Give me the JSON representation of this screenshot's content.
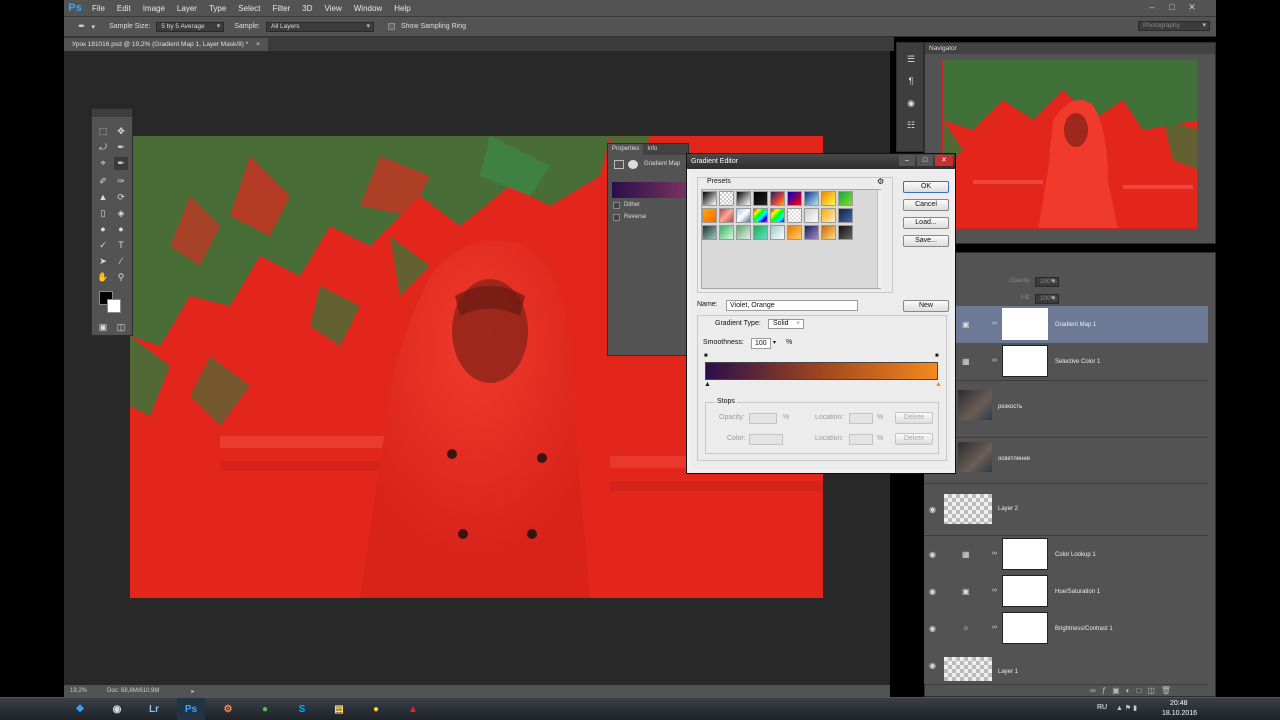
{
  "app": {
    "logo": "Ps",
    "workspace": "Photography"
  },
  "menu": [
    "File",
    "Edit",
    "Image",
    "Layer",
    "Type",
    "Select",
    "Filter",
    "3D",
    "View",
    "Window",
    "Help"
  ],
  "options": {
    "sample_size_label": "Sample Size:",
    "sample_size_value": "5 by 5 Average",
    "sample_label": "Sample:",
    "sample_value": "All Layers",
    "show_ring_label": "Show Sampling Ring"
  },
  "document": {
    "tab_title": "Урок 181016.psd @ 19,2% (Gradient Map 1, Layer Mask/8) *",
    "zoom": "19,2%",
    "doc_size": "Doc: 68,8M/610,9M"
  },
  "properties_panel": {
    "tabs": [
      "Properties",
      "Info"
    ],
    "layer_label": "Gradient Map",
    "dither_label": "Dither",
    "reverse_label": "Reverse"
  },
  "navigator": {
    "title": "Navigator"
  },
  "layers_panel": {
    "opacity_label": "Opacity:",
    "opacity_value": "100%",
    "fill_label": "Fill:",
    "fill_value": "100%",
    "layers": [
      {
        "name": "Gradient Map 1",
        "icon": "gradient-map-icon",
        "selected": true,
        "visible": false
      },
      {
        "name": "Selective Color 1",
        "icon": "selective-color-icon",
        "selected": false,
        "visible": false
      },
      {
        "name": "резкость",
        "icon": "photo-thumb",
        "selected": false,
        "visible": false
      },
      {
        "name": "осветление",
        "icon": "photo-thumb",
        "selected": false,
        "visible": false
      },
      {
        "name": "Layer 2",
        "icon": "transparent-thumb",
        "selected": false,
        "visible": true
      },
      {
        "name": "Color Lookup 1",
        "icon": "color-lookup-icon",
        "selected": false,
        "visible": true
      },
      {
        "name": "Hue/Saturation 1",
        "icon": "hue-saturation-icon",
        "selected": false,
        "visible": true
      },
      {
        "name": "Brightness/Contrast 1",
        "icon": "brightness-contrast-icon",
        "selected": false,
        "visible": true
      },
      {
        "name": "Layer 1",
        "icon": "photo-thumb",
        "selected": false,
        "visible": true
      }
    ]
  },
  "gradient_editor": {
    "title": "Gradient Editor",
    "presets_label": "Presets",
    "ok": "OK",
    "cancel": "Cancel",
    "load": "Load...",
    "save": "Save...",
    "name_label": "Name:",
    "name_value": "Violet, Orange",
    "new_button": "New",
    "gradient_type_label": "Gradient Type:",
    "gradient_type_value": "Solid",
    "smoothness_label": "Smoothness:",
    "smoothness_value": "100",
    "percent": "%",
    "stops_label": "Stops",
    "opacity_label": "Opacity:",
    "color_label": "Color:",
    "location_label": "Location:",
    "delete_label": "Delete",
    "gradient_colors": [
      "#2a0f4a",
      "#a0461e",
      "#f5881e"
    ]
  },
  "taskbar": {
    "lang": "RU",
    "time": "20:48",
    "date": "18.10.2016",
    "apps": [
      "windows-start",
      "obs",
      "Lr",
      "Ps",
      "settings",
      "chrome",
      "skype",
      "files",
      "coin",
      "acrobat"
    ]
  },
  "colors": {
    "photo_red": "#e2261c",
    "photo_green": "#2e7a3c",
    "ps_panel": "#535353",
    "selection": "#6c7a96"
  }
}
